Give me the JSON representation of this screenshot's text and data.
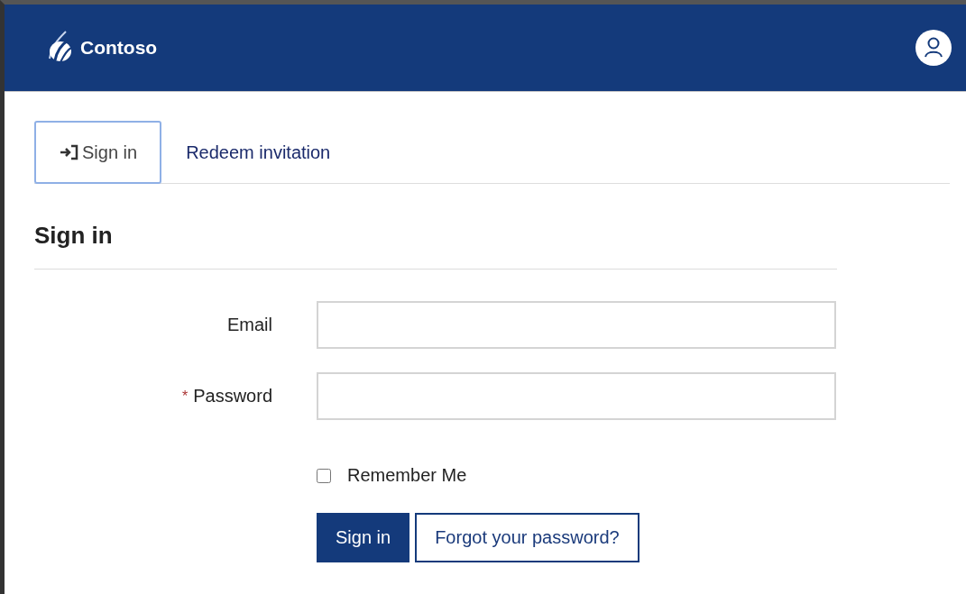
{
  "header": {
    "brand": "Contoso"
  },
  "tabs": [
    {
      "label": "Sign in",
      "selected": true,
      "kind": "with-icon"
    },
    {
      "label": "Redeem invitation",
      "selected": false,
      "kind": "plain"
    }
  ],
  "form": {
    "title": "Sign in",
    "fields": [
      {
        "label": "Email",
        "required": false
      },
      {
        "label": "Password",
        "required": true,
        "required_mark": "*"
      }
    ],
    "remember": {
      "label": "Remember Me",
      "checked": false
    },
    "buttons": [
      {
        "label": "Sign in",
        "kind": "primary"
      },
      {
        "label": "Forgot your password?",
        "kind": "secondary"
      }
    ]
  }
}
